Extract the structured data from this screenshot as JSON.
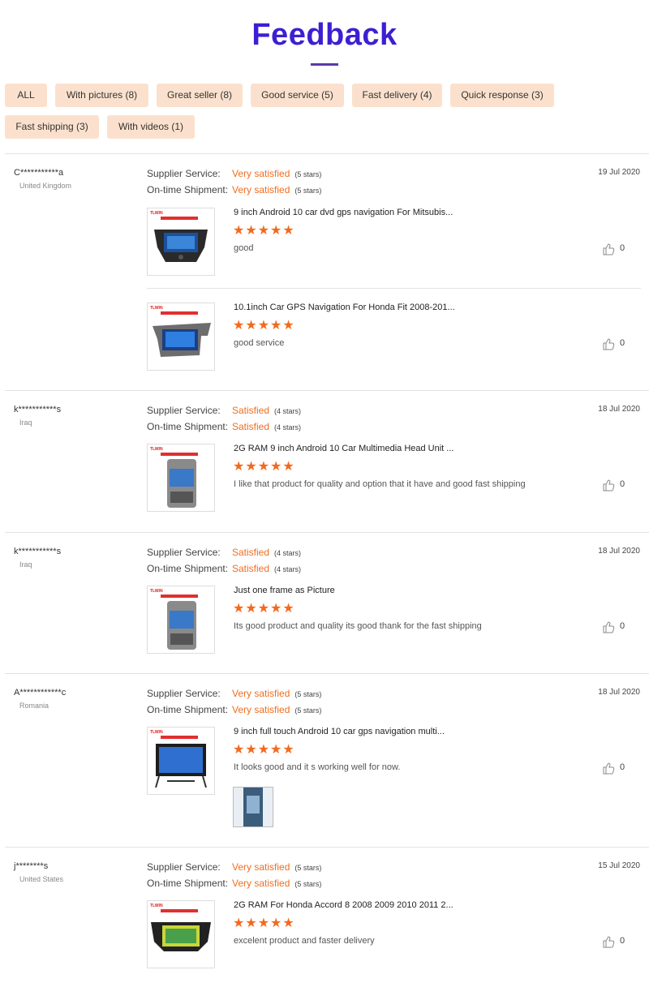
{
  "header": {
    "title": "Feedback"
  },
  "filters": [
    {
      "label": "ALL"
    },
    {
      "label": "With pictures (8)"
    },
    {
      "label": "Great seller (8)"
    },
    {
      "label": "Good service (5)"
    },
    {
      "label": "Fast delivery (4)"
    },
    {
      "label": "Quick response (3)"
    },
    {
      "label": "Fast shipping (3)"
    },
    {
      "label": "With videos (1)"
    }
  ],
  "labels": {
    "supplier": "Supplier Service:",
    "shipment": "On-time Shipment:"
  },
  "colors": {
    "accent": "#f06d1f",
    "chip_bg": "#fbe1cd",
    "title": "#3d1fd3"
  },
  "reviews": [
    {
      "name": "C***********a",
      "country": "United Kingdom",
      "date": "19 Jul 2020",
      "supplier": "Very satisfied",
      "supplier_stars": "(5 stars)",
      "shipment": "Very satisfied",
      "shipment_stars": "(5 stars)",
      "products": [
        {
          "title": "9 inch Android 10 car dvd gps navigation For Mitsubis...",
          "stars": "★★★★★",
          "rating": 5,
          "comment": "good",
          "likes": "0",
          "brand": "TLWIN"
        },
        {
          "title": "10.1inch Car GPS Navigation For Honda Fit 2008-201...",
          "stars": "★★★★★",
          "rating": 5,
          "comment": "good service",
          "likes": "0",
          "brand": "TLWIN"
        }
      ]
    },
    {
      "name": "k***********s",
      "country": "Iraq",
      "date": "18 Jul 2020",
      "supplier": "Satisfied",
      "supplier_stars": "(4 stars)",
      "shipment": "Satisfied",
      "shipment_stars": "(4 stars)",
      "products": [
        {
          "title": "2G RAM 9 inch Android 10 Car Multimedia Head Unit ...",
          "stars": "★★★★★",
          "rating": 5,
          "comment": "I like that product for quality and option that it have and good fast shipping",
          "likes": "0",
          "brand": "TLWIN"
        }
      ]
    },
    {
      "name": "k***********s",
      "country": "Iraq",
      "date": "18 Jul 2020",
      "supplier": "Satisfied",
      "supplier_stars": "(4 stars)",
      "shipment": "Satisfied",
      "shipment_stars": "(4 stars)",
      "products": [
        {
          "title": "Just one frame as Picture",
          "stars": "★★★★★",
          "rating": 5,
          "comment": "Its good product and quality its good thank for the fast shipping",
          "likes": "0",
          "brand": "TLWIN"
        }
      ]
    },
    {
      "name": "A************c",
      "country": "Romania",
      "date": "18 Jul 2020",
      "supplier": "Very satisfied",
      "supplier_stars": "(5 stars)",
      "shipment": "Very satisfied",
      "shipment_stars": "(5 stars)",
      "products": [
        {
          "title": "9 inch full touch Android 10 car gps navigation multi...",
          "stars": "★★★★★",
          "rating": 5,
          "comment": "It looks good and it s working well for now.",
          "likes": "0",
          "brand": "TLWIN"
        }
      ]
    },
    {
      "name": "j********s",
      "country": "United States",
      "date": "15 Jul 2020",
      "supplier": "Very satisfied",
      "supplier_stars": "(5 stars)",
      "shipment": "Very satisfied",
      "shipment_stars": "(5 stars)",
      "products": [
        {
          "title": "2G RAM For Honda Accord 8 2008 2009 2010 2011 2...",
          "stars": "★★★★★",
          "rating": 5,
          "comment": "excelent product and faster delivery",
          "likes": "0",
          "brand": "TLWIN"
        }
      ]
    }
  ]
}
